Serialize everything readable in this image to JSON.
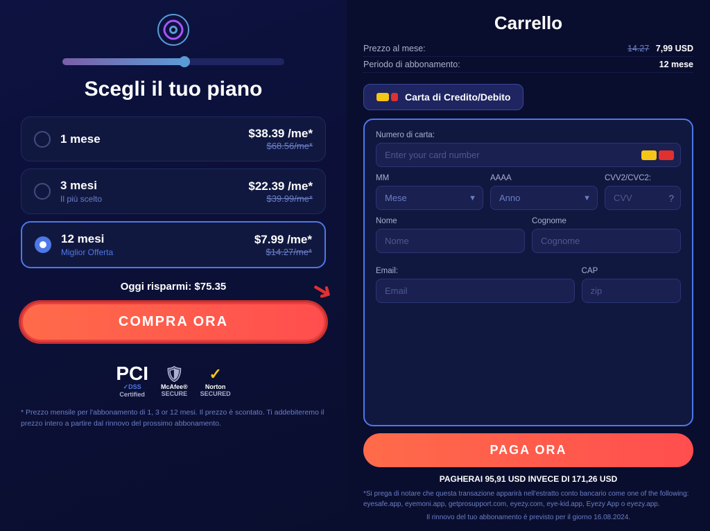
{
  "app": {
    "logo_label": "Eyezy logo"
  },
  "left": {
    "title": "Scegli il tuo piano",
    "progress_percent": 55,
    "plans": [
      {
        "id": "1mese",
        "name": "1 mese",
        "subtitle": "",
        "price": "$38.39 /me*",
        "old_price": "$68.56/me*",
        "selected": false,
        "badge": ""
      },
      {
        "id": "3mesi",
        "name": "3 mesi",
        "subtitle": "Il più scelto",
        "price": "$22.39 /me*",
        "old_price": "$39.99/me*",
        "selected": false,
        "badge": ""
      },
      {
        "id": "12mesi",
        "name": "12 mesi",
        "subtitle": "Miglior Offerta",
        "price": "$7.99 /me*",
        "old_price": "$14.27/me*",
        "selected": true,
        "badge": ""
      }
    ],
    "savings_label": "Oggi risparmi: $75.35",
    "buy_button": "COMPRA ORA",
    "trust_badges": [
      {
        "icon": "🛡",
        "line1": "PCI",
        "line2": "DSS",
        "line3": "Certified"
      },
      {
        "icon": "🛡",
        "line1": "McAfee",
        "line2": "SECURE"
      },
      {
        "icon": "✓",
        "line1": "Norton",
        "line2": "SECURED"
      }
    ],
    "footnote": "* Prezzo mensile per l'abbonamento di 1, 3 or 12 mesi. Il prezzo è scontato. Ti addebiteremo il prezzo intero a partire dal rinnovo del prossimo abbonamento."
  },
  "right": {
    "title": "Carrello",
    "summary_rows": [
      {
        "label": "Prezzo al mese:",
        "old_value": "14.27",
        "value": "7,99 USD"
      },
      {
        "label": "Periodo di abbonamento:",
        "value": "12 mese"
      }
    ],
    "payment_method_button": "Carta di Credito/Debito",
    "form": {
      "card_number_label": "Numero di carta:",
      "card_number_placeholder": "Enter your card number",
      "month_label": "MM",
      "month_placeholder": "Mese",
      "year_label": "AAAA",
      "year_placeholder": "Anno",
      "cvv_label": "CVV2/CVC2:",
      "cvv_placeholder": "CVV",
      "first_name_label": "Nome",
      "first_name_placeholder": "Nome",
      "last_name_label": "Cognome",
      "last_name_placeholder": "Cognome",
      "email_label": "Email:",
      "email_placeholder": "Email",
      "zip_label": "CAP",
      "zip_placeholder": "zip"
    },
    "pay_button": "PAGA ORA",
    "total_text": "PAGHERAI 95,91 USD INVECE DI 171,26 USD",
    "disclaimer": "*Si prega di notare che questa transazione apparirà nell'estratto conto bancario come one of the following: eyesafe.app, eyemoni.app, getprosupport.com, eyezy.com, eye-kid.app, Eyezy App o eyezy.app.",
    "renewal_text": "Il rinnovo del tuo abbonamento è previsto per il giorno 16.08.2024."
  }
}
